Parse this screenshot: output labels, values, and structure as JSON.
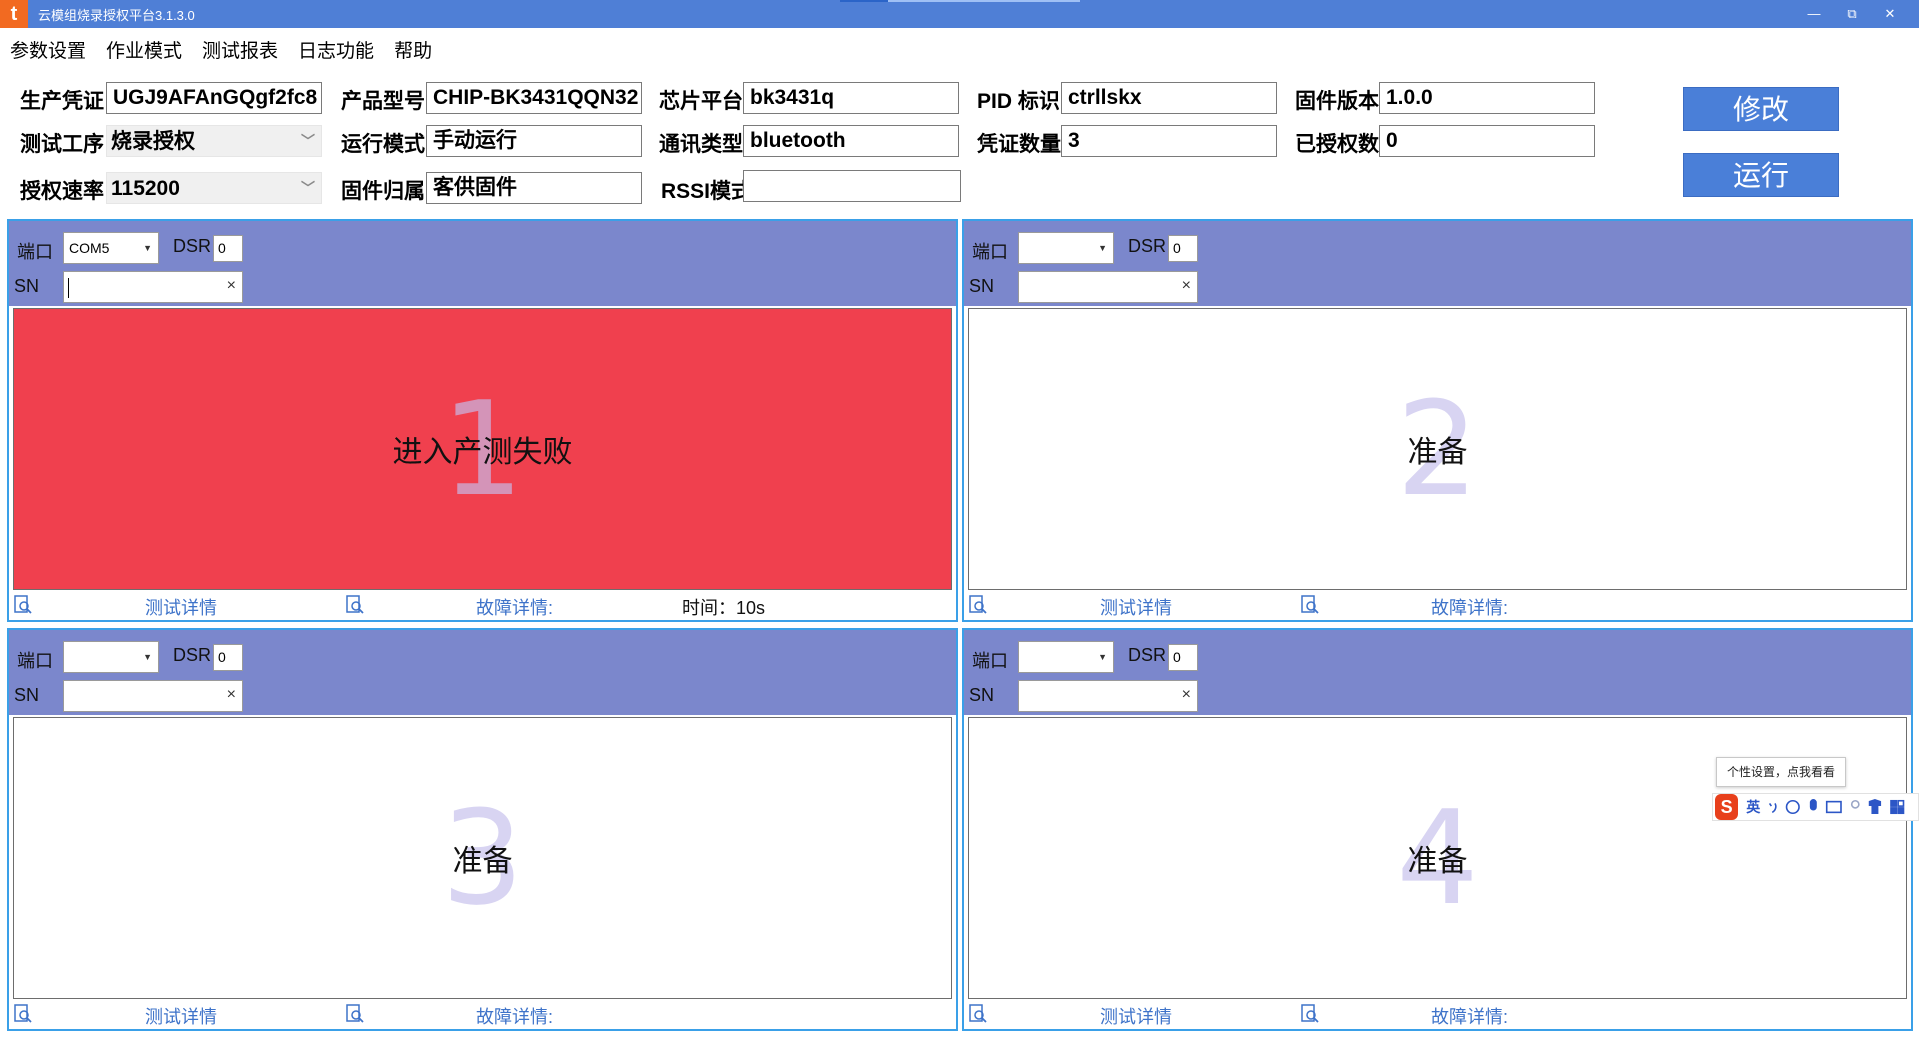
{
  "window": {
    "title": "云模组烧录授权平台3.1.3.0",
    "logo_glyph": "t",
    "controls": {
      "minimize": "—",
      "restore": "⧉",
      "close": "✕"
    }
  },
  "menu": [
    "参数设置",
    "作业模式",
    "测试报表",
    "日志功能",
    "帮助"
  ],
  "form": {
    "credential_label": "生产凭证:",
    "credential_value": "UGJ9AFAnGQgf2fc8",
    "product_label": "产品型号:",
    "product_value": "CHIP-BK3431QQN32",
    "chip_label": "芯片平台:",
    "chip_value": "bk3431q",
    "pid_label": "PID 标识:",
    "pid_value": "ctrllskx",
    "fw_version_label": "固件版本:",
    "fw_version_value": "1.0.0",
    "process_label": "测试工序:",
    "process_value": "烧录授权",
    "run_mode_label": "运行模式:",
    "run_mode_value": "手动运行",
    "comm_label": "通讯类型:",
    "comm_value": "bluetooth",
    "cred_count_label": "凭证数量:",
    "cred_count_value": "3",
    "authorized_label": "已授权数:",
    "authorized_value": "0",
    "baud_label": "授权速率:",
    "baud_value": "115200",
    "fw_owner_label": "固件归属:",
    "fw_owner_value": "客供固件",
    "rssi_label": "RSSI模式",
    "rssi_value": ""
  },
  "buttons": {
    "modify": "修改",
    "run": "运行"
  },
  "panel_labels": {
    "port": "端口",
    "dsr": "DSR",
    "sn": "SN",
    "detail": "测试详情",
    "fault": "故障详情:",
    "clear": "×"
  },
  "panels": [
    {
      "number": "1",
      "port": "COM5",
      "dsr": "0",
      "sn": "",
      "status": "进入产测失败",
      "time": "时间：10s",
      "state": "fail"
    },
    {
      "number": "2",
      "port": "",
      "dsr": "0",
      "sn": "",
      "status": "准备",
      "time": "",
      "state": "ready"
    },
    {
      "number": "3",
      "port": "",
      "dsr": "0",
      "sn": "",
      "status": "准备",
      "time": "",
      "state": "ready"
    },
    {
      "number": "4",
      "port": "",
      "dsr": "0",
      "sn": "",
      "status": "准备",
      "time": "",
      "state": "ready"
    }
  ],
  "ime": {
    "tip": "个性设置，点我看看",
    "logo": "S",
    "lang": "英",
    "icons": [
      "punct-icon",
      "emoji-icon",
      "mic-icon",
      "keyboard-icon",
      "user-icon",
      "skin-icon",
      "toolbox-icon"
    ]
  },
  "colors": {
    "titlebar": "#4f7fd6",
    "panel_header": "#7b87cc",
    "fail": "#f0404e",
    "button": "#4a7fd8",
    "link": "#3e73c9"
  }
}
